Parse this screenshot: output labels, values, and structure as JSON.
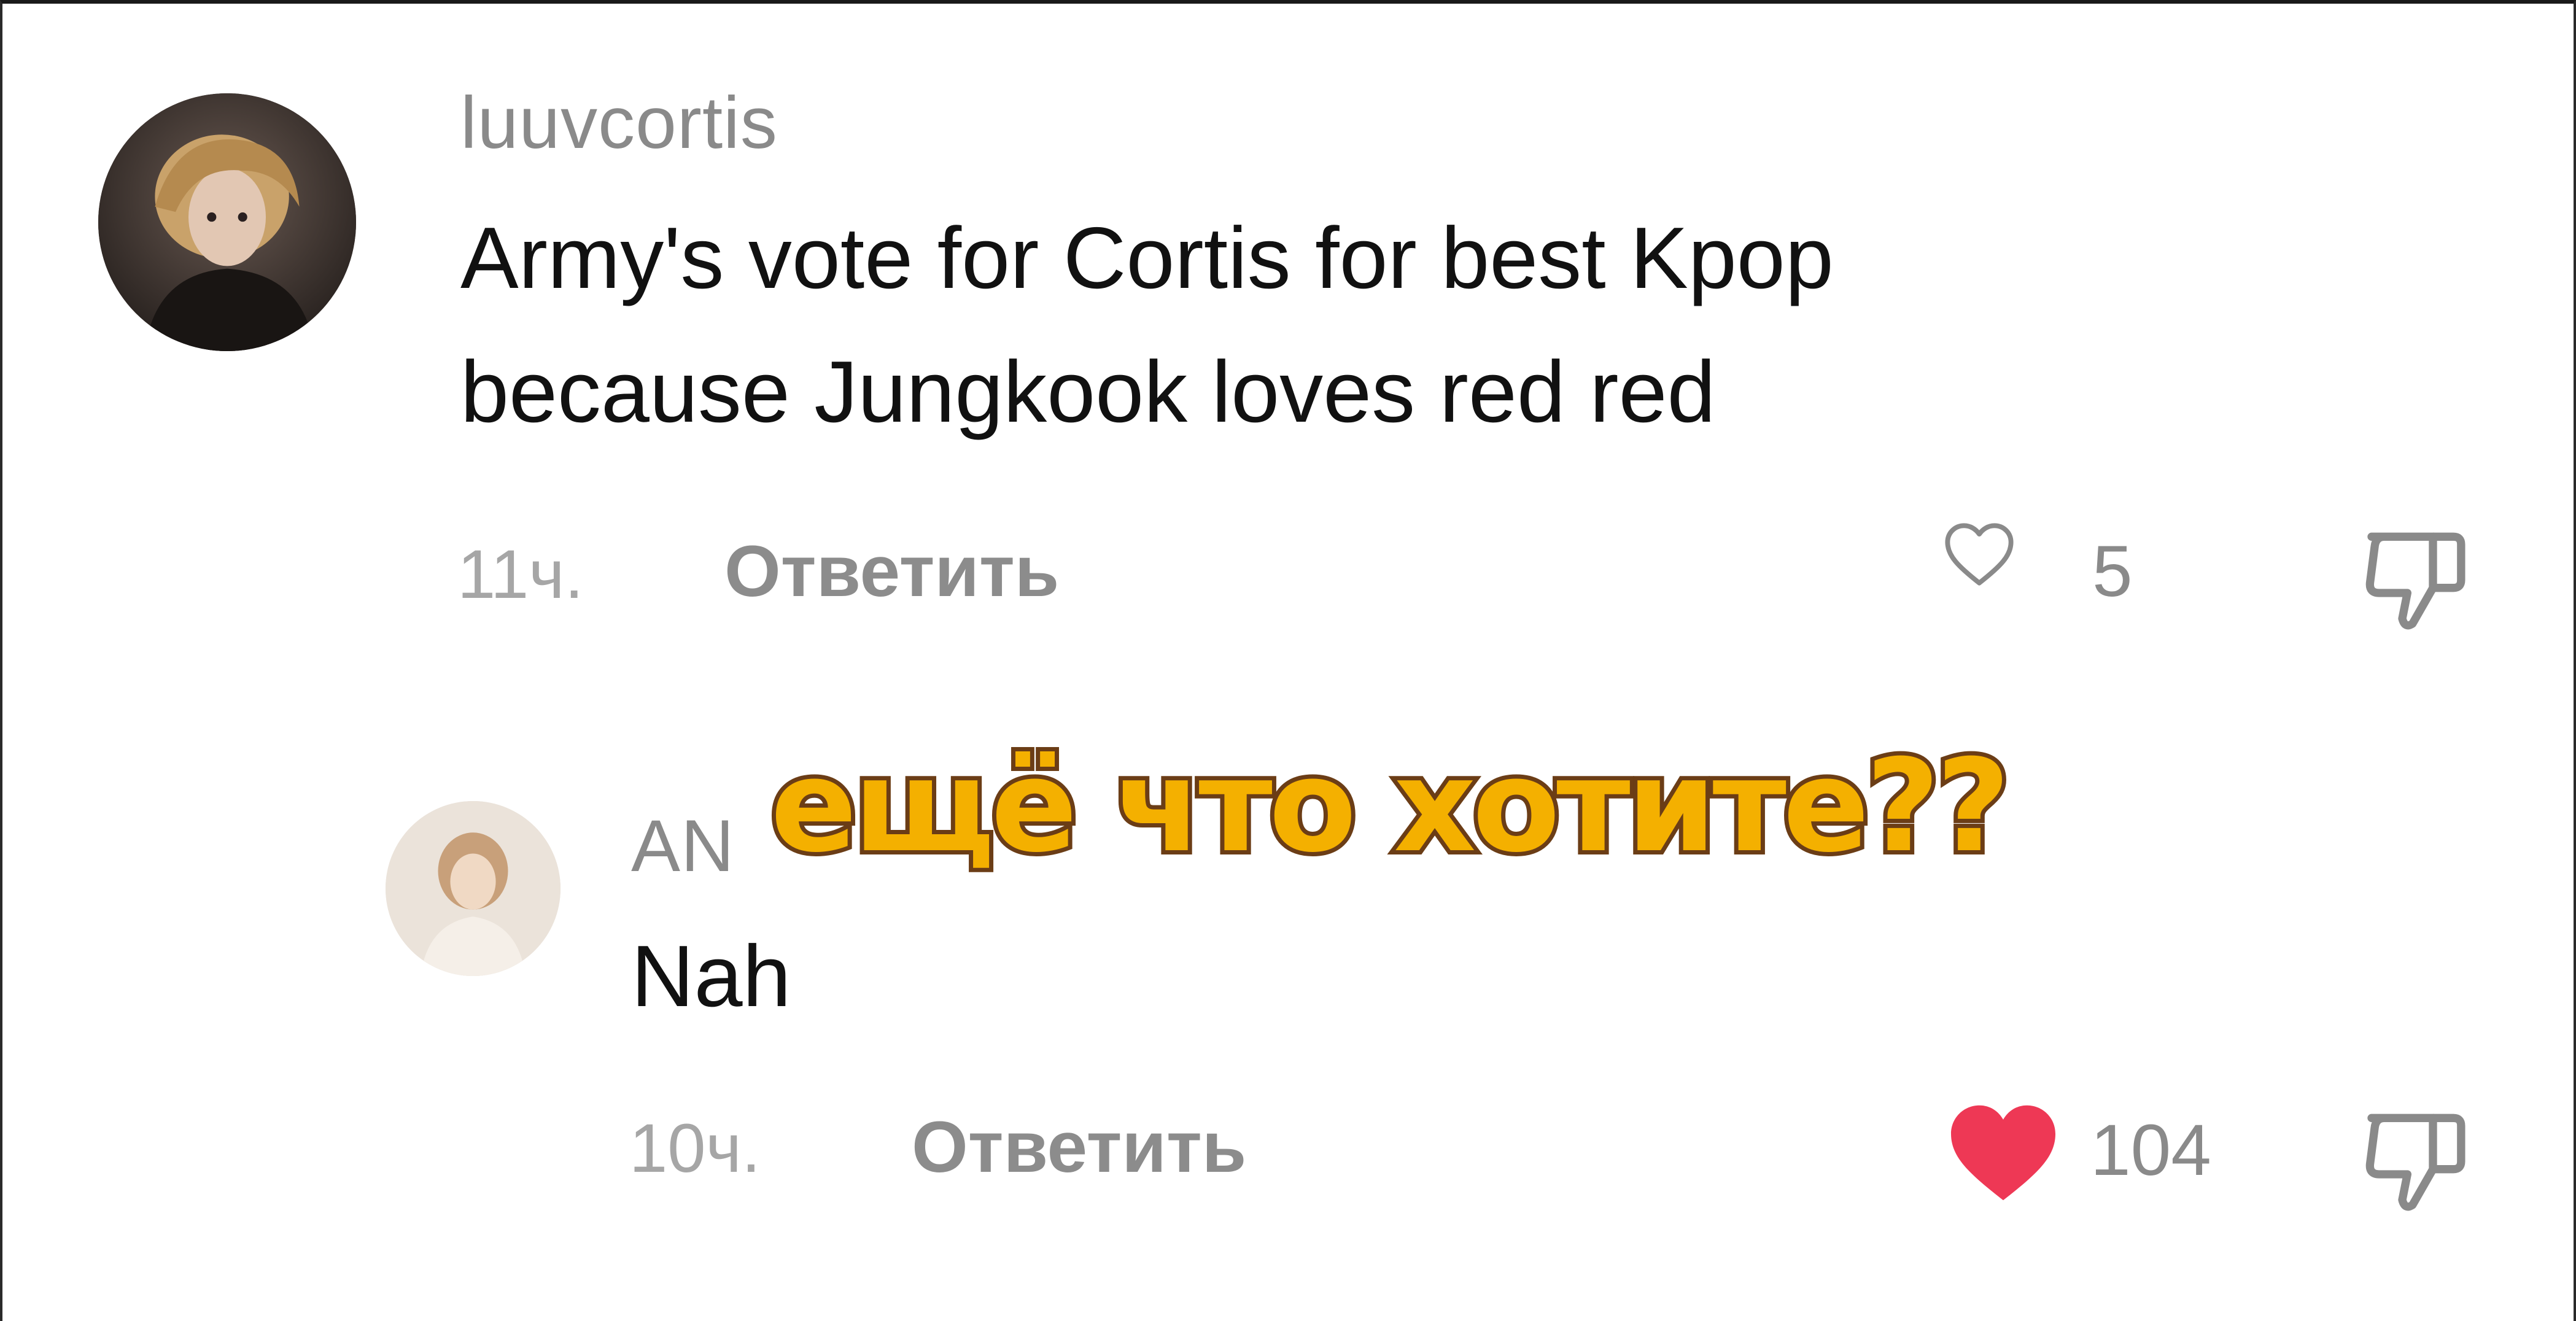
{
  "comments": [
    {
      "username": "luuvcortis",
      "text_line1": "Army's vote for Cortis for best Kpop",
      "text_line2": "because Jungkook loves red red",
      "time": "11ч.",
      "reply_label": "Ответить",
      "likes": "5",
      "liked": false
    },
    {
      "username": "AN",
      "text_line1": "Nah",
      "time": "10ч.",
      "reply_label": "Ответить",
      "likes": "104",
      "liked": true
    }
  ],
  "overlay_caption": "ещё что хотите??",
  "colors": {
    "like_active": "#ee3855",
    "caption_fill": "#f4b000",
    "caption_stroke": "#6b3d16"
  },
  "icons": {
    "like": "heart-icon",
    "dislike": "thumbs-down-icon"
  }
}
